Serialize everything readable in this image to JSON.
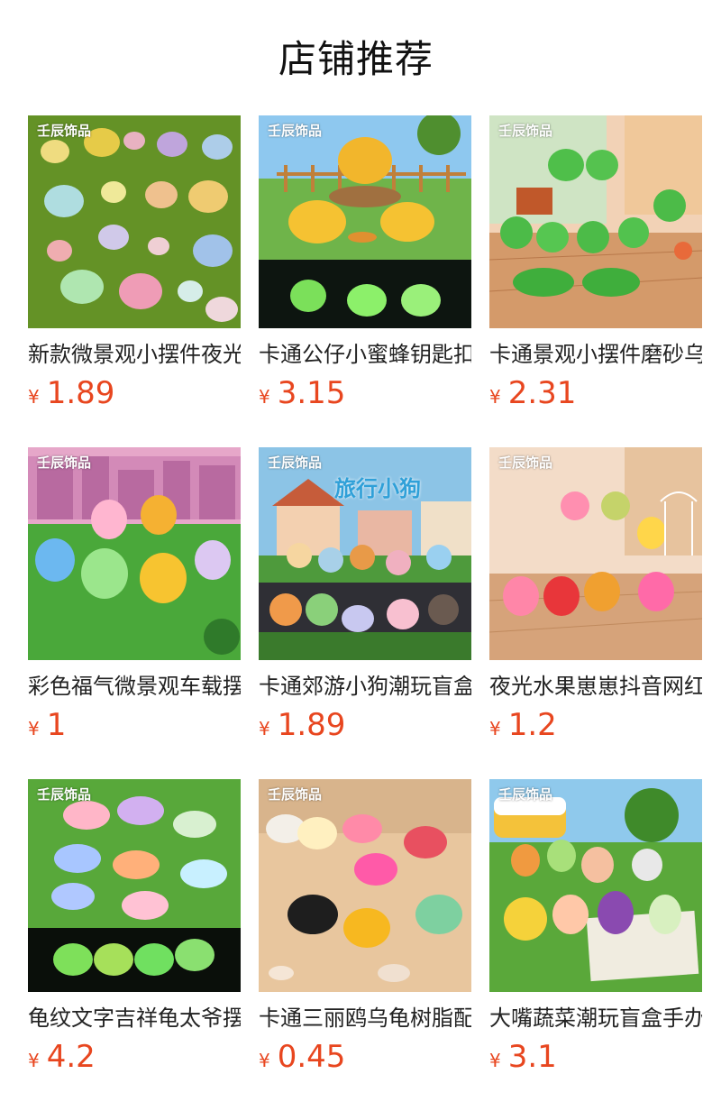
{
  "header": {
    "title": "店铺推荐"
  },
  "currency": "¥",
  "products": [
    {
      "name": "新款微景观小摆件夜光",
      "price": "1.89",
      "brand": "壬辰饰品",
      "scene": "turtles-grass"
    },
    {
      "name": "卡通公仔小蜜蜂钥匙扣",
      "price": "3.15",
      "brand": "壬辰饰品",
      "scene": "bees"
    },
    {
      "name": "卡通景观小摆件磨砂乌龟",
      "price": "2.31",
      "brand": "壬辰饰品",
      "scene": "green-turtles"
    },
    {
      "name": "彩色福气微景观车载摆件",
      "price": "1",
      "brand": "壬辰饰品",
      "scene": "hooded-figures"
    },
    {
      "name": "卡通郊游小狗潮玩盲盒",
      "price": "1.89",
      "brand": "壬辰饰品",
      "scene": "travel-dogs",
      "overlay": "旅行小狗"
    },
    {
      "name": "夜光水果崽崽抖音网红",
      "price": "1.2",
      "brand": "壬辰饰品",
      "scene": "fruit-kids"
    },
    {
      "name": "龟纹文字吉祥龟太爷摆件",
      "price": "4.2",
      "brand": "壬辰饰品",
      "scene": "glow-turtles"
    },
    {
      "name": "卡通三丽鸥乌龟树脂配件",
      "price": "0.45",
      "brand": "壬辰饰品",
      "scene": "beach-turtles"
    },
    {
      "name": "大嘴蔬菜潮玩盲盒手办",
      "price": "3.1",
      "brand": "壬辰饰品",
      "scene": "veggies-picnic"
    }
  ],
  "colors": {
    "price": "#e8461f",
    "title": "#111111",
    "text": "#222222"
  }
}
